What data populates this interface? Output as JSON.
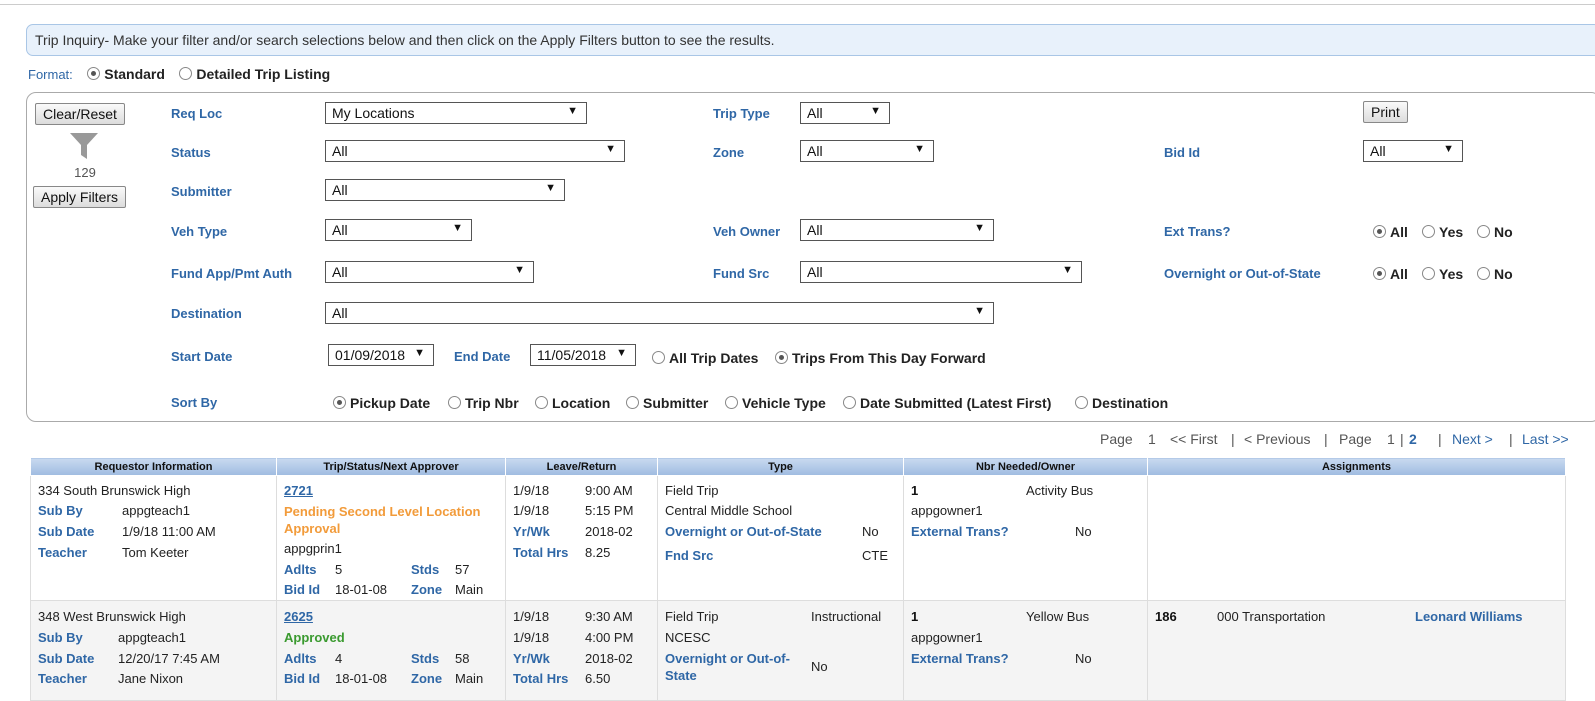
{
  "banner": "Trip Inquiry- Make your filter and/or search selections below and then click on the Apply Filters button to see the results.",
  "format": {
    "label": "Format:",
    "options": [
      "Standard",
      "Detailed Trip Listing"
    ],
    "selected": "Standard"
  },
  "filters": {
    "clear_label": "Clear/Reset",
    "apply_label": "Apply Filters",
    "print_label": "Print",
    "count": "129",
    "req_loc": {
      "label": "Req Loc",
      "value": "My Locations"
    },
    "trip_type": {
      "label": "Trip Type",
      "value": "All"
    },
    "status": {
      "label": "Status",
      "value": "All"
    },
    "zone": {
      "label": "Zone",
      "value": "All"
    },
    "bid_id": {
      "label": "Bid Id",
      "value": "All"
    },
    "submitter": {
      "label": "Submitter",
      "value": "All"
    },
    "veh_type": {
      "label": "Veh Type",
      "value": "All"
    },
    "veh_owner": {
      "label": "Veh Owner",
      "value": "All"
    },
    "ext_trans": {
      "label": "Ext Trans?",
      "options": [
        "All",
        "Yes",
        "No"
      ],
      "selected": "All"
    },
    "fund_app": {
      "label": "Fund App/Pmt Auth",
      "value": "All"
    },
    "fund_src": {
      "label": "Fund Src",
      "value": "All"
    },
    "overnight": {
      "label": "Overnight or Out-of-State",
      "options": [
        "All",
        "Yes",
        "No"
      ],
      "selected": "All"
    },
    "destination": {
      "label": "Destination",
      "value": "All"
    },
    "start_date": {
      "label": "Start Date",
      "value": "01/09/2018"
    },
    "end_date": {
      "label": "End Date",
      "value": "11/05/2018"
    },
    "date_options": [
      "All Trip Dates",
      "Trips From This Day Forward"
    ],
    "date_selected": "Trips From This Day Forward",
    "sort_by": {
      "label": "Sort By",
      "options": [
        "Pickup Date",
        "Trip Nbr",
        "Location",
        "Submitter",
        "Vehicle Type",
        "Date Submitted (Latest First)",
        "Destination"
      ],
      "selected": "Pickup Date"
    }
  },
  "pager": {
    "page_label": "Page",
    "current_top": "1",
    "first": "<< First",
    "previous": "< Previous",
    "page_label2": "Page",
    "p1": "1",
    "p2": "2",
    "next": "Next >",
    "last": "Last >>",
    "sep": "|"
  },
  "table": {
    "headers": [
      "Requestor Information",
      "Trip/Status/Next Approver",
      "Leave/Return",
      "Type",
      "Nbr Needed/Owner",
      "Assignments"
    ],
    "labels": {
      "sub_by": "Sub By",
      "sub_date": "Sub Date",
      "teacher": "Teacher",
      "adlts": "Adlts",
      "stds": "Stds",
      "bid_id": "Bid Id",
      "zone": "Zone",
      "yrwk": "Yr/Wk",
      "total_hrs": "Total Hrs",
      "overnight": "Overnight or Out-of-State",
      "overnight_a": "Overnight or Out-of-",
      "overnight_b": "State",
      "fnd_src": "Fnd Src",
      "ext_trans": "External Trans?"
    },
    "rows": [
      {
        "location": "334 South Brunswick High",
        "sub_by": "appgteach1",
        "sub_date": "1/9/18 11:00 AM",
        "teacher": "Tom Keeter",
        "trip_nbr": "2721",
        "status_line1": "Pending Second Level Location",
        "status_line2": "Approval",
        "approver": "appgprin1",
        "adlts": "5",
        "stds": "57",
        "bid_id": "18-01-08",
        "zone": "Main",
        "leave_date": "1/9/18",
        "leave_time": "9:00 AM",
        "return_date": "1/9/18",
        "return_time": "5:15 PM",
        "yrwk": "2018-02",
        "total_hrs": "8.25",
        "type": "Field Trip",
        "destination": "Central Middle School",
        "overnight": "No",
        "fnd_src": "CTE",
        "nbr": "1",
        "veh": "Activity Bus",
        "owner": "appgowner1",
        "ext_trans": "No"
      },
      {
        "location": "348 West Brunswick High",
        "sub_by": "appgteach1",
        "sub_date": "12/20/17 7:45 AM",
        "teacher": "Jane Nixon",
        "trip_nbr": "2625",
        "status": "Approved",
        "adlts": "4",
        "stds": "58",
        "bid_id": "18-01-08",
        "zone": "Main",
        "leave_date": "1/9/18",
        "leave_time": "9:30 AM",
        "return_date": "1/9/18",
        "return_time": "4:00 PM",
        "yrwk": "2018-02",
        "total_hrs": "6.50",
        "type": "Field Trip",
        "subtype": "Instructional",
        "destination": "NCESC",
        "overnight": "No",
        "nbr": "1",
        "veh": "Yellow Bus",
        "owner": "appgowner1",
        "ext_trans": "No",
        "assign_nbr": "186",
        "assign_dept": "000 Transportation",
        "assign_driver": "Leonard Williams"
      }
    ]
  }
}
